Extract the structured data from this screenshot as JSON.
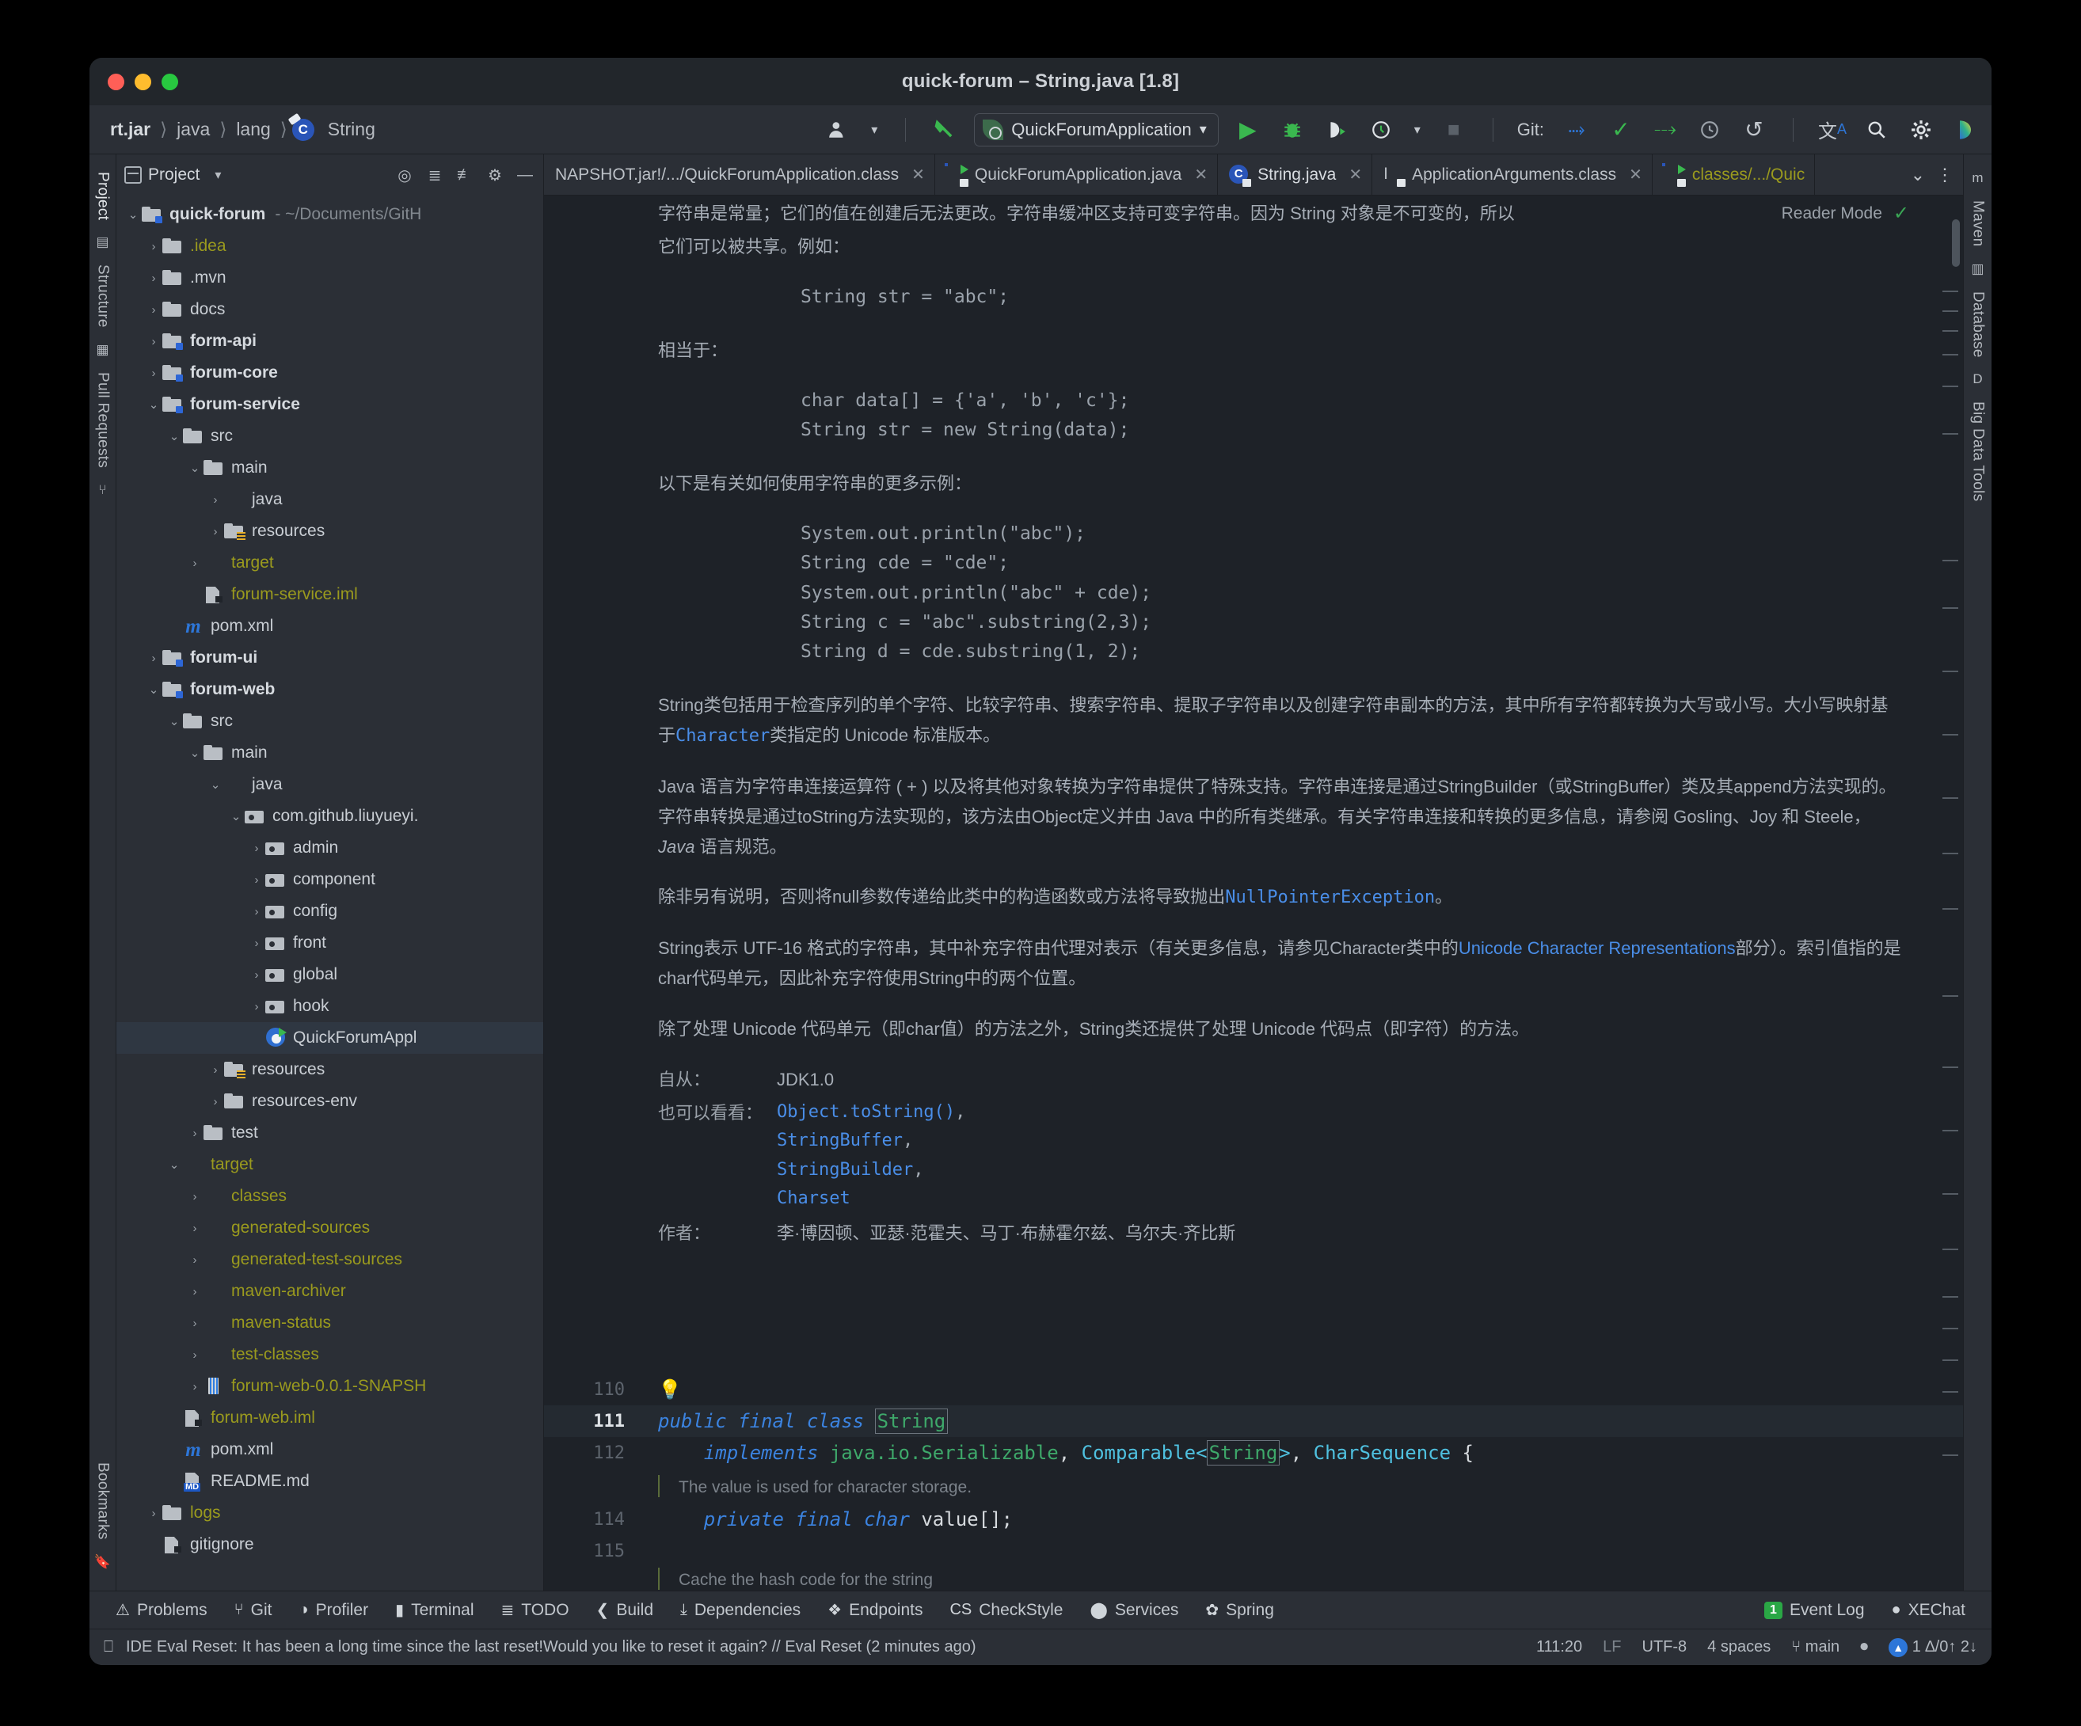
{
  "window": {
    "title": "quick-forum – String.java [1.8]"
  },
  "breadcrumb": {
    "items": [
      "rt.jar",
      "java",
      "lang",
      "String"
    ],
    "class_badge": "C"
  },
  "toolbar": {
    "run_config": "QuickForumApplication",
    "git_label": "Git:",
    "icons": {
      "user": "user-icon",
      "hammer": "build-hammer-icon",
      "run": "run-icon",
      "debug": "debug-icon",
      "run_coverage": "run-with-coverage-icon",
      "profiler": "profiler-icon",
      "stop": "stop-icon",
      "update": "git-update-icon",
      "commit": "git-commit-icon",
      "push": "git-push-icon",
      "history": "git-history-icon",
      "rollback": "git-rollback-icon",
      "translate": "translate-icon",
      "search": "search-everywhere-icon",
      "settings": "settings-gear-icon",
      "ai": "ai-assistant-icon"
    }
  },
  "left_rail": {
    "tabs": [
      "Project",
      "Structure",
      "Pull Requests"
    ],
    "bottom_tabs": [
      "Bookmarks"
    ]
  },
  "right_rail": {
    "tabs": [
      "Maven",
      "Database",
      "Big Data Tools"
    ]
  },
  "project_panel": {
    "title": "Project",
    "header_icons": [
      "project-select-icon",
      "chevron-down-icon",
      "locate-icon",
      "expand-all-icon",
      "collapse-all-icon",
      "settings-gear-icon",
      "hide-icon"
    ],
    "tree": [
      {
        "depth": 0,
        "arrow": "down",
        "icon": "module",
        "label": "quick-forum",
        "bold": true,
        "suffix": "- ~/Documents/GitH"
      },
      {
        "depth": 1,
        "arrow": "right",
        "icon": "folder",
        "label": ".idea",
        "yellow": true
      },
      {
        "depth": 1,
        "arrow": "right",
        "icon": "folder",
        "label": ".mvn"
      },
      {
        "depth": 1,
        "arrow": "right",
        "icon": "folder",
        "label": "docs"
      },
      {
        "depth": 1,
        "arrow": "right",
        "icon": "module",
        "label": "form-api",
        "bold": true
      },
      {
        "depth": 1,
        "arrow": "right",
        "icon": "module",
        "label": "forum-core",
        "bold": true
      },
      {
        "depth": 1,
        "arrow": "down",
        "icon": "module",
        "label": "forum-service",
        "bold": true
      },
      {
        "depth": 2,
        "arrow": "down",
        "icon": "folder",
        "label": "src"
      },
      {
        "depth": 3,
        "arrow": "down",
        "icon": "folder",
        "label": "main"
      },
      {
        "depth": 4,
        "arrow": "right",
        "icon": "src",
        "label": "java"
      },
      {
        "depth": 4,
        "arrow": "right",
        "icon": "res",
        "label": "resources"
      },
      {
        "depth": 3,
        "arrow": "right",
        "icon": "red",
        "label": "target",
        "yellow": true
      },
      {
        "depth": 3,
        "arrow": "none",
        "icon": "iml",
        "label": "forum-service.iml",
        "yellow": true
      },
      {
        "depth": 2,
        "arrow": "none",
        "icon": "maven",
        "label": "pom.xml"
      },
      {
        "depth": 1,
        "arrow": "right",
        "icon": "module",
        "label": "forum-ui",
        "bold": true
      },
      {
        "depth": 1,
        "arrow": "down",
        "icon": "module",
        "label": "forum-web",
        "bold": true
      },
      {
        "depth": 2,
        "arrow": "down",
        "icon": "folder",
        "label": "src"
      },
      {
        "depth": 3,
        "arrow": "down",
        "icon": "folder",
        "label": "main"
      },
      {
        "depth": 4,
        "arrow": "down",
        "icon": "src",
        "label": "java"
      },
      {
        "depth": 5,
        "arrow": "down",
        "icon": "pkg",
        "label": "com.github.liuyueyi."
      },
      {
        "depth": 6,
        "arrow": "right",
        "icon": "pkg",
        "label": "admin"
      },
      {
        "depth": 6,
        "arrow": "right",
        "icon": "pkg",
        "label": "component"
      },
      {
        "depth": 6,
        "arrow": "right",
        "icon": "pkg",
        "label": "config"
      },
      {
        "depth": 6,
        "arrow": "right",
        "icon": "pkg",
        "label": "front"
      },
      {
        "depth": 6,
        "arrow": "right",
        "icon": "pkg",
        "label": "global"
      },
      {
        "depth": 6,
        "arrow": "right",
        "icon": "pkg",
        "label": "hook"
      },
      {
        "depth": 6,
        "arrow": "none",
        "icon": "spring",
        "label": "QuickForumAppl",
        "selected": true
      },
      {
        "depth": 4,
        "arrow": "right",
        "icon": "res",
        "label": "resources"
      },
      {
        "depth": 4,
        "arrow": "right",
        "icon": "folder",
        "label": "resources-env"
      },
      {
        "depth": 3,
        "arrow": "right",
        "icon": "folder",
        "label": "test"
      },
      {
        "depth": 2,
        "arrow": "down",
        "icon": "red",
        "label": "target",
        "yellow": true
      },
      {
        "depth": 3,
        "arrow": "right",
        "icon": "red",
        "label": "classes",
        "yellow": true
      },
      {
        "depth": 3,
        "arrow": "right",
        "icon": "red",
        "label": "generated-sources",
        "yellow": true
      },
      {
        "depth": 3,
        "arrow": "right",
        "icon": "red",
        "label": "generated-test-sources",
        "yellow": true
      },
      {
        "depth": 3,
        "arrow": "right",
        "icon": "red",
        "label": "maven-archiver",
        "yellow": true
      },
      {
        "depth": 3,
        "arrow": "right",
        "icon": "red",
        "label": "maven-status",
        "yellow": true
      },
      {
        "depth": 3,
        "arrow": "right",
        "icon": "red",
        "label": "test-classes",
        "yellow": true
      },
      {
        "depth": 3,
        "arrow": "right",
        "icon": "jar",
        "label": "forum-web-0.0.1-SNAPSH",
        "yellow": true
      },
      {
        "depth": 2,
        "arrow": "none",
        "icon": "iml",
        "label": "forum-web.iml",
        "yellow": true
      },
      {
        "depth": 2,
        "arrow": "none",
        "icon": "maven",
        "label": "pom.xml"
      },
      {
        "depth": 2,
        "arrow": "none",
        "icon": "md",
        "label": "README.md"
      },
      {
        "depth": 1,
        "arrow": "right",
        "icon": "folder",
        "label": "logs",
        "yellow": true
      },
      {
        "depth": 1,
        "arrow": "none",
        "icon": "iml",
        "label": "gitignore"
      }
    ]
  },
  "editor_tabs": [
    {
      "label": "NAPSHOT.jar!/.../QuickForumApplication.class",
      "icon": "none",
      "active": false,
      "closable": true
    },
    {
      "label": "QuickForumApplication.java",
      "icon": "sboot",
      "active": false,
      "closable": true
    },
    {
      "label": "String.java",
      "icon": "clsj",
      "active": true,
      "closable": true
    },
    {
      "label": "ApplicationArguments.class",
      "icon": "iface",
      "active": false,
      "closable": true
    },
    {
      "label": "classes/.../Quic",
      "icon": "sboot",
      "active": false,
      "closable": false,
      "yellow": true
    }
  ],
  "editor_tabs_right": {
    "chevron": "chevron-down-icon",
    "more": "more-options-icon"
  },
  "reader_mode": {
    "label": "Reader Mode",
    "check": "✓"
  },
  "javadoc": {
    "clipped_line_1": "字符串是常量；它们的值在创建后无法更改。字符串缓冲区支持可变字符串。因为 String 对象是不可变的，所以",
    "clipped_line_2": "它们可以被共享。例如：",
    "code1": "String str = \"abc\";",
    "equiv_label": "相当于：",
    "code2": "char data[] = {'a', 'b', 'c'};\nString str = new String(data);",
    "more_examples_label": "以下是有关如何使用字符串的更多示例：",
    "code3": "System.out.println(\"abc\");\nString cde = \"cde\";\nSystem.out.println(\"abc\" + cde);\nString c = \"abc\".substring(2,3);\nString d = cde.substring(1, 2);",
    "para1_a": "String类包括用于检查序列的单个字符、比较字符串、搜索字符串、提取子字符串以及创建字符串副本的方法，其中所有字符都转换为大写或小写。大小写映射基于",
    "para1_link": "Character",
    "para1_b": "类指定的 Unicode 标准版本。",
    "para2_a": "Java 语言为字符串连接运算符 ( + ) 以及将其他对象转换为字符串提供了特殊支持。字符串连接是通过StringBuilder（或StringBuffer）类及其append方法实现的。字符串转换是通过toString方法实现的，该方法由Object定义并由 Java 中的所有类继承。有关字符串连接和转换的更多信息，请参阅 Gosling、Joy 和 Steele，",
    "para2_ital": "Java",
    "para2_b": "语言规范。",
    "para3_a": "除非另有说明，否则将null参数传递给此类中的构造函数或方法将导致抛出",
    "para3_link": "NullPointerException",
    "para3_b": "。",
    "para4_a": "String表示 UTF-16 格式的字符串，其中补充字符由代理对表示（有关更多信息，请参见Character类中的",
    "para4_link": "Unicode Character Representations",
    "para4_b": "部分）。索引值指的是char代码单元，因此补充字符使用String中的两个位置。",
    "para5": "除了处理 Unicode 代码单元（即char值）的方法之外，String类还提供了处理 Unicode 代码点（即字符）的方法。",
    "since_label": "自从：",
    "since_value": "JDK1.0",
    "seealso_label": "也可以看看：",
    "seealso_items": [
      "Object.toString()",
      "StringBuffer",
      "StringBuilder",
      "Charset"
    ],
    "author_label": "作者：",
    "author_value": "李·博因顿、亚瑟·范霍夫、马丁·布赫霍尔兹、乌尔夫·齐比斯"
  },
  "code": {
    "lines": [
      {
        "num": "110",
        "kind": "bulb"
      },
      {
        "num": "111",
        "kind": "decl",
        "current": true
      },
      {
        "num": "112",
        "kind": "impl"
      },
      {
        "num": "",
        "kind": "comment",
        "text": "The value is used for character storage."
      },
      {
        "num": "114",
        "kind": "field"
      },
      {
        "num": "115",
        "kind": "blank"
      },
      {
        "num": "",
        "kind": "comment2",
        "text": "Cache the hash code for the string"
      }
    ],
    "decl": {
      "kw1": "public",
      "kw2": "final",
      "kw3": "class",
      "name": "String"
    },
    "impl": {
      "kw": "implements",
      "t1": "java.io.Serializable",
      "t2": "Comparable<",
      "t2b": "String",
      "t2c": ">",
      "t3": "CharSequence",
      "brace": "{"
    },
    "field": {
      "kw1": "private",
      "kw2": "final",
      "kw3": "char",
      "name": "value[];"
    }
  },
  "tool_windows": {
    "left_items": [
      {
        "label": "Problems",
        "icon": "problems-icon"
      },
      {
        "label": "Git",
        "icon": "git-branch-icon"
      },
      {
        "label": "Profiler",
        "icon": "profiler-icon"
      },
      {
        "label": "Terminal",
        "icon": "terminal-icon"
      },
      {
        "label": "TODO",
        "icon": "todo-list-icon"
      },
      {
        "label": "Build",
        "icon": "build-hammer-icon"
      },
      {
        "label": "Dependencies",
        "icon": "dependencies-icon"
      },
      {
        "label": "Endpoints",
        "icon": "endpoints-icon"
      },
      {
        "label": "CheckStyle",
        "icon": "checkstyle-icon"
      },
      {
        "label": "Services",
        "icon": "services-icon"
      },
      {
        "label": "Spring",
        "icon": "spring-leaf-icon"
      }
    ],
    "right_items": [
      {
        "label": "Event Log",
        "icon": "event-log-icon",
        "badge": "1"
      },
      {
        "label": "XEChat",
        "icon": "xechat-icon"
      }
    ]
  },
  "status_bar": {
    "message": "IDE Eval Reset: It has been a long time since the last reset!Would you like to reset it again? // Eval Reset (2 minutes ago)",
    "caret": "111:20",
    "line_sep": "LF",
    "encoding": "UTF-8",
    "indent": "4 spaces",
    "branch": "main",
    "inspections": "1 ∆/0↑ 2↓"
  },
  "colors": {
    "accent_blue": "#2d76d8",
    "green": "#3aa655",
    "yellow": "#9a9a1e",
    "link": "#4a8ee8",
    "bg": "#2b2f36",
    "editor_bg": "#1e2228"
  }
}
